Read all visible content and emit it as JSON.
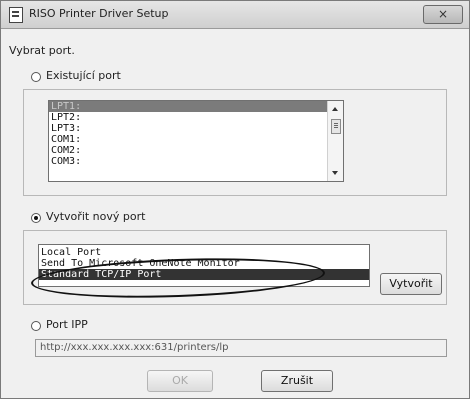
{
  "window": {
    "title": "RISO Printer Driver Setup",
    "close_label": "×"
  },
  "main": {
    "prompt": "Vybrat port.",
    "existing_port": {
      "radio_label": "Existující port",
      "items": [
        "LPT1:",
        "LPT2:",
        "LPT3:",
        "COM1:",
        "COM2:",
        "COM3:"
      ],
      "selected_index": 0
    },
    "new_port": {
      "radio_label": "Vytvořit nový port",
      "items": [
        "Local Port",
        "Send To Microsoft OneNote Monitor",
        "Standard TCP/IP Port"
      ],
      "selected_index": 2,
      "create_button": "Vytvořit"
    },
    "ipp": {
      "radio_label": "Port IPP",
      "url": "http://xxx.xxx.xxx.xxx:631/printers/lp"
    }
  },
  "footer": {
    "ok_label": "OK",
    "cancel_label": "Zrušit"
  }
}
